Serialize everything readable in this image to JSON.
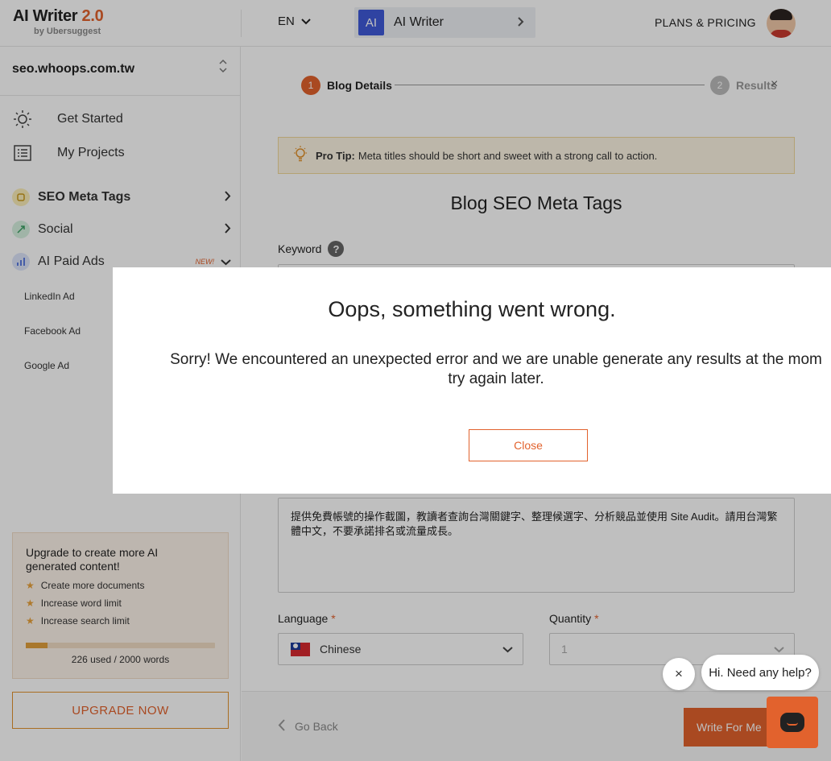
{
  "header": {
    "logo_main": "AI Writer",
    "logo_version": "2.0",
    "logo_sub": "by Ubersuggest",
    "language": "EN",
    "crumb_badge": "AI",
    "crumb_label": "AI Writer",
    "plans_label": "PLANS & PRICING"
  },
  "sidebar": {
    "site": "seo.whoops.com.tw",
    "nav": [
      {
        "label": "Get Started",
        "icon": "sun-icon"
      },
      {
        "label": "My Projects",
        "icon": "list-icon"
      }
    ],
    "categories": [
      {
        "label": "SEO Meta Tags",
        "color": "#e9c24b"
      },
      {
        "label": "Social",
        "color": "#53b87c"
      },
      {
        "label": "AI Paid Ads",
        "color": "#5b7be0",
        "badge": "NEW!"
      }
    ],
    "sub_items": [
      "LinkedIn Ad",
      "Facebook Ad",
      "Google Ad"
    ],
    "upgrade": {
      "title": "Upgrade to create more AI generated content!",
      "items": [
        "Create more documents",
        "Increase word limit",
        "Increase search limit"
      ],
      "progress_fraction": 0.113,
      "used_text": "226 used / 2000 words",
      "button": "UPGRADE NOW"
    }
  },
  "main": {
    "step1_num": "1",
    "step1_label": "Blog Details",
    "step2_num": "2",
    "step2_label": "Results",
    "close_glyph": "×",
    "tip_label": "Pro Tip:",
    "tip_text": "Meta titles should be short and sweet with a strong call to action.",
    "form_title": "Blog SEO Meta Tags",
    "keyword_label": "Keyword",
    "help_glyph": "?",
    "description": "提供免費帳號的操作截圖，教讀者查詢台灣關鍵字、整理候選字、分析競品並使用 Site Audit。請用台灣繁體中文，不要承諾排名或流量成長。",
    "language_label": "Language",
    "language_value": "Chinese",
    "quantity_label": "Quantity",
    "quantity_value": "1",
    "required_mark": "*",
    "go_back": "Go Back",
    "write_btn": "Write For Me"
  },
  "modal": {
    "title": "Oops, something went wrong.",
    "body_line1": "Sorry! We encountered an unexpected error and we are unable generate any results at the mom",
    "body_line2": "try again later.",
    "close": "Close"
  },
  "chat": {
    "bubble": "Hi. Need any help?",
    "dismiss_glyph": "×"
  },
  "colors": {
    "accent": "#e2622d",
    "brand_blue": "#3f5ad8"
  }
}
